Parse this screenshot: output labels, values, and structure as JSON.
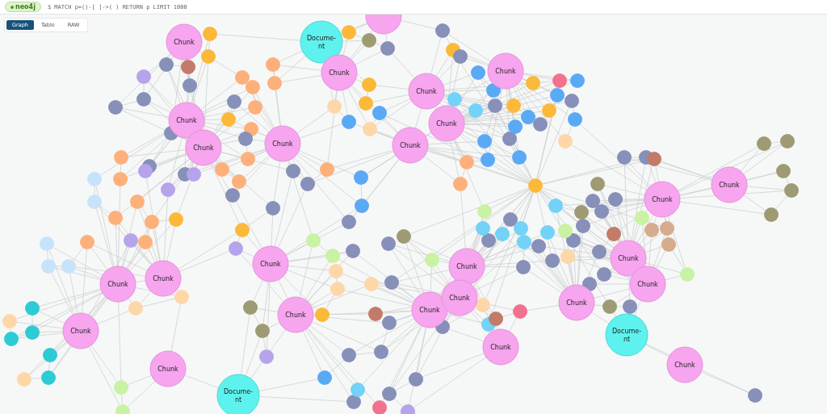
{
  "query_bar": {
    "badge": "neo4j",
    "query": "$ MATCH p=()-[ ]->( ) RETURN p LIMIT 1000"
  },
  "view_tabs": [
    {
      "label": "Graph",
      "selected": true
    },
    {
      "label": "Table",
      "selected": false
    },
    {
      "label": "RAW",
      "selected": false
    }
  ],
  "graph": {
    "nodes": [
      {
        "kind": "chunk",
        "label_lines": [
          "Chunk"
        ]
      },
      {
        "kind": "document",
        "label_lines": [
          "Docume-",
          "nt"
        ]
      },
      {
        "kind": "chunk",
        "label_lines": [
          "Chunk"
        ]
      },
      {
        "kind": "chunk",
        "label_lines": [
          "Chunk"
        ]
      },
      {
        "kind": "chunk",
        "label_lines": [
          "Chunk"
        ]
      },
      {
        "kind": "chunk",
        "label_lines": [
          "Chunk"
        ]
      },
      {
        "kind": "chunk",
        "label_lines": [
          "Chunk"
        ]
      },
      {
        "kind": "chunk",
        "label_lines": [
          "Chunk"
        ]
      },
      {
        "kind": "chunk",
        "label_lines": [
          "Chunk"
        ]
      },
      {
        "kind": "chunk",
        "label_lines": [
          "Chunk"
        ]
      },
      {
        "kind": "chunk",
        "label_lines": [
          "Chunk"
        ]
      },
      {
        "kind": "chunk",
        "label_lines": [
          "Chunk"
        ]
      },
      {
        "kind": "chunk",
        "label_lines": [
          "Chunk"
        ]
      },
      {
        "kind": "chunk",
        "label_lines": [
          "Chunk"
        ]
      },
      {
        "kind": "chunk",
        "label_lines": [
          "Chunk"
        ]
      },
      {
        "kind": "chunk",
        "label_lines": [
          "Chunk"
        ]
      },
      {
        "kind": "chunk",
        "label_lines": [
          "Chunk"
        ]
      },
      {
        "kind": "chunk",
        "label_lines": [
          "Chunk"
        ]
      },
      {
        "kind": "chunk",
        "label_lines": [
          "Chunk"
        ]
      },
      {
        "kind": "chunk",
        "label_lines": [
          "Chunk"
        ]
      },
      {
        "kind": "chunk",
        "label_lines": [
          "Chunk"
        ]
      },
      {
        "kind": "chunk",
        "label_lines": [
          "Chunk"
        ]
      },
      {
        "kind": "chunk",
        "label_lines": [
          "Chunk"
        ]
      },
      {
        "kind": "document",
        "label_lines": [
          "Docume-",
          "nt"
        ]
      },
      {
        "kind": "chunk",
        "label_lines": [
          "Chunk"
        ]
      },
      {
        "kind": "document",
        "label_lines": [
          "Docume-",
          "nt"
        ]
      },
      {
        "kind": "chunk",
        "label_lines": [
          "Chunk"
        ]
      },
      {
        "kind": "chunk",
        "label_lines": [
          "Chunk"
        ]
      },
      {
        "kind": "chunk"
      }
    ],
    "entities": [
      {
        "color": "#fbb93a"
      },
      {
        "color": "#fbb93a"
      },
      {
        "color": "#fbb93a"
      },
      {
        "color": "#fbb93a"
      },
      {
        "color": "#fbb93a"
      },
      {
        "color": "#fbb93a"
      },
      {
        "color": "#fbb93a"
      },
      {
        "color": "#fbb93a"
      },
      {
        "color": "#fbb93a"
      },
      {
        "color": "#fbb93a"
      },
      {
        "color": "#fbb93a"
      },
      {
        "color": "#fbb93a"
      },
      {
        "color": "#fbb93a"
      },
      {
        "color": "#fbb93a"
      },
      {
        "color": "#fdb07a"
      },
      {
        "color": "#fdb07a"
      },
      {
        "color": "#fdb07a"
      },
      {
        "color": "#fdb07a"
      },
      {
        "color": "#fdb07a"
      },
      {
        "color": "#fdb07a"
      },
      {
        "color": "#fdb07a"
      },
      {
        "color": "#fdb07a"
      },
      {
        "color": "#fdb07a"
      },
      {
        "color": "#fdb07a"
      },
      {
        "color": "#fdb07a"
      },
      {
        "color": "#fdb07a"
      },
      {
        "color": "#fdb07a"
      },
      {
        "color": "#fdb07a"
      },
      {
        "color": "#fdb07a"
      },
      {
        "color": "#fdb07a"
      },
      {
        "color": "#fdb07a"
      },
      {
        "color": "#fdb07a"
      },
      {
        "color": "#fdb07a"
      },
      {
        "color": "#fdd7a8"
      },
      {
        "color": "#fdd7a8"
      },
      {
        "color": "#fdd7a8"
      },
      {
        "color": "#fdd7a8"
      },
      {
        "color": "#fdd7a8"
      },
      {
        "color": "#fdd7a8"
      },
      {
        "color": "#fdd7a8"
      },
      {
        "color": "#fdd7a8"
      },
      {
        "color": "#fdd7a8"
      },
      {
        "color": "#fdd7a8"
      },
      {
        "color": "#fdd7a8"
      },
      {
        "color": "#fdd7a8"
      },
      {
        "color": "#8690b8"
      },
      {
        "color": "#8690b8"
      },
      {
        "color": "#8690b8"
      },
      {
        "color": "#8690b8"
      },
      {
        "color": "#8690b8"
      },
      {
        "color": "#8690b8"
      },
      {
        "color": "#8690b8"
      },
      {
        "color": "#8690b8"
      },
      {
        "color": "#8690b8"
      },
      {
        "color": "#8690b8"
      },
      {
        "color": "#8690b8"
      },
      {
        "color": "#8690b8"
      },
      {
        "color": "#8690b8"
      },
      {
        "color": "#8690b8"
      },
      {
        "color": "#8690b8"
      },
      {
        "color": "#8690b8"
      },
      {
        "color": "#8690b8"
      },
      {
        "color": "#8690b8"
      },
      {
        "color": "#8690b8"
      },
      {
        "color": "#8690b8"
      },
      {
        "color": "#8690b8"
      },
      {
        "color": "#8690b8"
      },
      {
        "color": "#8690b8"
      },
      {
        "color": "#8690b8"
      },
      {
        "color": "#8690b8"
      },
      {
        "color": "#8690b8"
      },
      {
        "color": "#8690b8"
      },
      {
        "color": "#8690b8"
      },
      {
        "color": "#8690b8"
      },
      {
        "color": "#8690b8"
      },
      {
        "color": "#8690b8"
      },
      {
        "color": "#8690b8"
      },
      {
        "color": "#8690b8"
      },
      {
        "color": "#8690b8"
      },
      {
        "color": "#8690b8"
      },
      {
        "color": "#8690b8"
      },
      {
        "color": "#8690b8"
      },
      {
        "color": "#8690b8"
      },
      {
        "color": "#8690b8"
      },
      {
        "color": "#8690b8"
      },
      {
        "color": "#8690b8"
      },
      {
        "color": "#8690b8"
      },
      {
        "color": "#8690b8"
      },
      {
        "color": "#8690b8"
      },
      {
        "color": "#8690b8"
      },
      {
        "color": "#8690b8"
      },
      {
        "color": "#8690b8"
      },
      {
        "color": "#8690b8"
      },
      {
        "color": "#5aa9f5"
      },
      {
        "color": "#5aa9f5"
      },
      {
        "color": "#5aa9f5"
      },
      {
        "color": "#5aa9f5"
      },
      {
        "color": "#5aa9f5"
      },
      {
        "color": "#5aa9f5"
      },
      {
        "color": "#5aa9f5"
      },
      {
        "color": "#5aa9f5"
      },
      {
        "color": "#5aa9f5"
      },
      {
        "color": "#5aa9f5"
      },
      {
        "color": "#5aa9f5"
      },
      {
        "color": "#5aa9f5"
      },
      {
        "color": "#5aa9f5"
      },
      {
        "color": "#5aa9f5"
      },
      {
        "color": "#5aa9f5"
      },
      {
        "color": "#72d2f7"
      },
      {
        "color": "#72d2f7"
      },
      {
        "color": "#72d2f7"
      },
      {
        "color": "#72d2f7"
      },
      {
        "color": "#72d2f7"
      },
      {
        "color": "#72d2f7"
      },
      {
        "color": "#72d2f7"
      },
      {
        "color": "#72d2f7"
      },
      {
        "color": "#72d2f7"
      },
      {
        "color": "#72d2f7"
      },
      {
        "color": "#b5a4ec"
      },
      {
        "color": "#b5a4ec"
      },
      {
        "color": "#b5a4ec"
      },
      {
        "color": "#b5a4ec"
      },
      {
        "color": "#b5a4ec"
      },
      {
        "color": "#b5a4ec"
      },
      {
        "color": "#b5a4ec"
      },
      {
        "color": "#b5a4ec"
      },
      {
        "color": "#9e9b74"
      },
      {
        "color": "#9e9b74"
      },
      {
        "color": "#9e9b74"
      },
      {
        "color": "#9e9b74"
      },
      {
        "color": "#9e9b74"
      },
      {
        "color": "#9e9b74"
      },
      {
        "color": "#9e9b74"
      },
      {
        "color": "#9e9b74"
      },
      {
        "color": "#9e9b74"
      },
      {
        "color": "#9e9b74"
      },
      {
        "color": "#9e9b74"
      },
      {
        "color": "#9e9b74"
      },
      {
        "color": "#c27b69"
      },
      {
        "color": "#c27b69"
      },
      {
        "color": "#c27b69"
      },
      {
        "color": "#c27b69"
      },
      {
        "color": "#c27b69"
      },
      {
        "color": "#d6ab8e"
      },
      {
        "color": "#d6ab8e"
      },
      {
        "color": "#d6ab8e"
      },
      {
        "color": "#c9f2a4"
      },
      {
        "color": "#c9f2a4"
      },
      {
        "color": "#c9f2a4"
      },
      {
        "color": "#c9f2a4"
      },
      {
        "color": "#c9f2a4"
      },
      {
        "color": "#c9f2a4"
      },
      {
        "color": "#c9f2a4"
      },
      {
        "color": "#c9f2a4"
      },
      {
        "color": "#c9f2a4"
      },
      {
        "color": "#2ccbd6"
      },
      {
        "color": "#2ccbd6"
      },
      {
        "color": "#2ccbd6"
      },
      {
        "color": "#2ccbd6"
      },
      {
        "color": "#2ccbd6"
      },
      {
        "color": "#f0728f"
      },
      {
        "color": "#f0728f"
      },
      {
        "color": "#f0728f"
      },
      {
        "color": "#c7e3fb"
      },
      {
        "color": "#c7e3fb"
      },
      {
        "color": "#c7e3fb"
      },
      {
        "color": "#c7e3fb"
      },
      {
        "color": "#c7e3fb"
      }
    ]
  }
}
